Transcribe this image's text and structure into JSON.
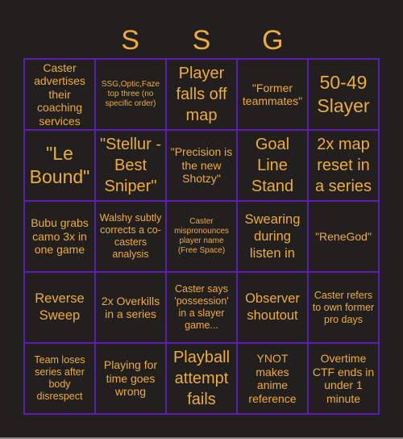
{
  "header": {
    "letters": [
      "",
      "S",
      "S",
      "G",
      ""
    ]
  },
  "colors": {
    "background": "#221f1f",
    "grid_line": "#5c1db4",
    "text": "#eeac3a"
  },
  "board": {
    "cells": [
      {
        "text": "Caster advertises their coaching services",
        "size": "m"
      },
      {
        "text": "SSG,Optic,Faze top three (no specific order)",
        "size": "xs"
      },
      {
        "text": "Player falls off map",
        "size": "xl"
      },
      {
        "text": "\"Former teammates\"",
        "size": "m"
      },
      {
        "text": "50-49 Slayer",
        "size": "xxl"
      },
      {
        "text": "\"Le Bound\"",
        "size": "xxl"
      },
      {
        "text": "\"Stellur - Best Sniper\"",
        "size": "xl"
      },
      {
        "text": "\"Precision is the new Shotzy\"",
        "size": "m"
      },
      {
        "text": "Goal Line Stand",
        "size": "xl"
      },
      {
        "text": "2x map reset in a series",
        "size": "xl"
      },
      {
        "text": "Bubu grabs camo 3x in one game",
        "size": "m"
      },
      {
        "text": "Walshy subtly corrects a co-casters analysis",
        "size": "s"
      },
      {
        "text": "Caster mispronounces player name (Free Space)",
        "size": "xs"
      },
      {
        "text": "Swearing during listen in",
        "size": "l"
      },
      {
        "text": "\"ReneGod\"",
        "size": "m"
      },
      {
        "text": "Reverse Sweep",
        "size": "l"
      },
      {
        "text": "2x Overkills in a series",
        "size": "m"
      },
      {
        "text": "Caster says 'possession' in a slayer game...",
        "size": "s"
      },
      {
        "text": "Observer shoutout",
        "size": "l"
      },
      {
        "text": "Caster refers to own former pro days",
        "size": "s"
      },
      {
        "text": "Team loses series after body disrespect",
        "size": "s"
      },
      {
        "text": "Playing for time goes wrong",
        "size": "m"
      },
      {
        "text": "Playball attempt fails",
        "size": "xl"
      },
      {
        "text": "YNOT makes anime reference",
        "size": "m"
      },
      {
        "text": "Overtime CTF ends in under 1 minute",
        "size": "m"
      }
    ]
  }
}
